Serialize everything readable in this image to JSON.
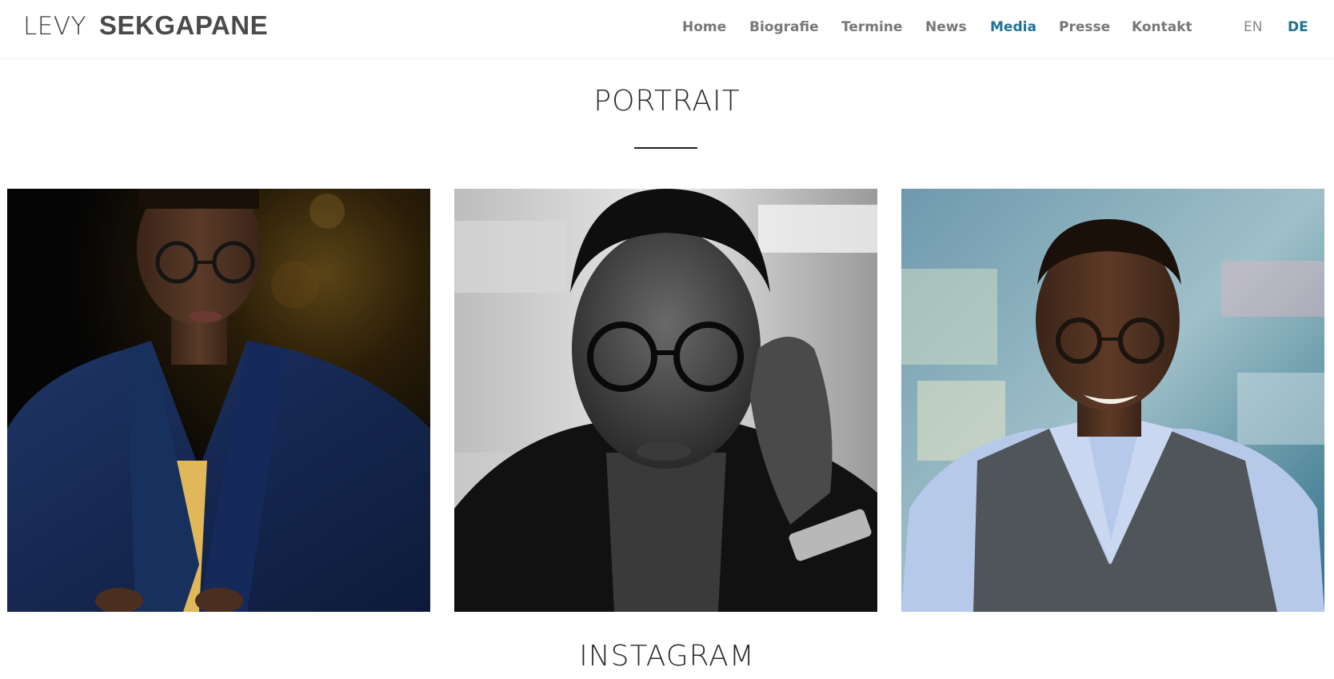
{
  "header": {
    "logo_first": "LEVY",
    "logo_last": "SEKGAPANE",
    "nav": [
      {
        "label": "Home",
        "active": false
      },
      {
        "label": "Biografie",
        "active": false
      },
      {
        "label": "Termine",
        "active": false
      },
      {
        "label": "News",
        "active": false
      },
      {
        "label": "Media",
        "active": true
      },
      {
        "label": "Presse",
        "active": false
      },
      {
        "label": "Kontakt",
        "active": false
      }
    ],
    "languages": [
      {
        "label": "EN",
        "active": false
      },
      {
        "label": "DE",
        "active": true
      }
    ]
  },
  "sections": {
    "portrait_title": "PORTRAIT",
    "instagram_title": "INSTAGRAM"
  },
  "gallery": [
    {
      "name": "portrait-photo-navy-blazer",
      "style": "dark background, navy blazer, yellow top"
    },
    {
      "name": "portrait-photo-black-white",
      "style": "black and white, hand on glasses"
    },
    {
      "name": "portrait-photo-grey-vest",
      "style": "blue bokeh background, light blue shirt, grey vest"
    }
  ],
  "colors": {
    "accent": "#1f7396",
    "nav_text": "#777777",
    "title_text": "#2a2a2a"
  }
}
